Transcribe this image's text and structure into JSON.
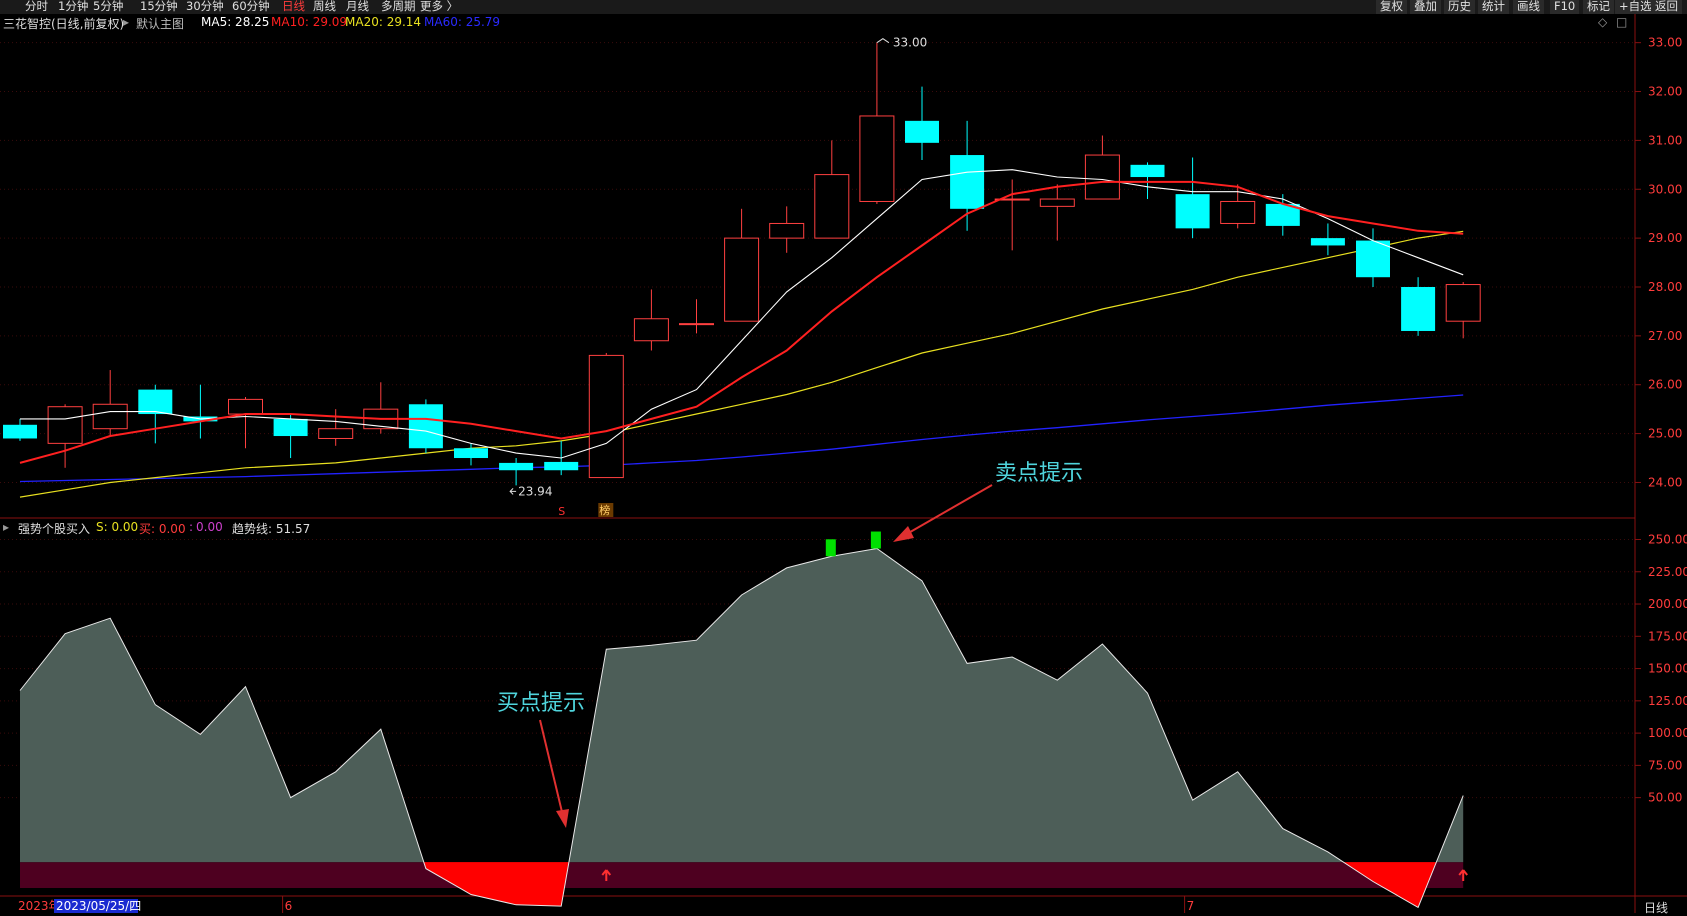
{
  "toolbar": {
    "tabs": [
      "分时",
      "1分钟",
      "5分钟",
      "15分钟",
      "30分钟",
      "60分钟",
      "日线",
      "周线",
      "月线",
      "多周期",
      "更多 〉"
    ],
    "active_tab": "日线",
    "right_buttons": [
      "复权",
      "叠加",
      "历史",
      "统计",
      "画线",
      "F10",
      "标记",
      "+自选",
      "返回"
    ]
  },
  "main_panel": {
    "title": "三花智控(日线,前复权)",
    "template": "默认主图",
    "ma": [
      {
        "label": "MA5: 28.25",
        "color": "#ffffff"
      },
      {
        "label": "MA10: 29.09",
        "color": "#ff2020"
      },
      {
        "label": "MA20: 29.14",
        "color": "#e8e020"
      },
      {
        "label": "MA60: 25.79",
        "color": "#2a2aff"
      }
    ],
    "markers": {
      "high_label": "33.00",
      "low_label": "23.94",
      "s_marker": "S",
      "bang_marker": "榜"
    },
    "window_controls": [
      "◇",
      "□"
    ]
  },
  "sub_panel": {
    "title": "强势个股买入",
    "s_label": "S: 0.00",
    "buy_label": "买: 0.00",
    "sep": ":",
    "zero_label": "0.00",
    "trend_label": "趋势线: 51.57",
    "annotations": {
      "sell": "卖点提示",
      "buy": "买点提示"
    }
  },
  "x_axis": {
    "labels": [
      {
        "text": "2023年",
        "i": 0
      },
      {
        "text": "2023/05/25/四",
        "i": 1,
        "highlight": true
      },
      {
        "text": "6",
        "i": 6
      },
      {
        "text": "7",
        "i": 26
      }
    ]
  },
  "bottom_right": "日线",
  "colors": {
    "up": "#ff4040",
    "down": "#00ffff",
    "ma5": "#ffffff",
    "ma10": "#ff2020",
    "ma20": "#e8e020",
    "ma60": "#2222ff",
    "area": "#4d5e58",
    "neg": "#ff0000",
    "band": "#4e0020",
    "axis": "#ff3c3c",
    "buy_arrow": "#ff3030",
    "sell_mark": "#00e000"
  },
  "chart_data": [
    {
      "type": "candlestick",
      "title": "三花智控(日线,前复权)",
      "ylim": [
        23.6,
        33.3
      ],
      "y_ticks": [
        24,
        25,
        26,
        27,
        28,
        29,
        30,
        31,
        32,
        33
      ],
      "candles": [
        {
          "o": 25.18,
          "c": 24.9,
          "h": 25.3,
          "l": 24.85
        },
        {
          "o": 24.8,
          "c": 25.55,
          "h": 25.6,
          "l": 24.3
        },
        {
          "o": 25.1,
          "c": 25.6,
          "h": 26.3,
          "l": 24.95
        },
        {
          "o": 25.9,
          "c": 25.4,
          "h": 26.0,
          "l": 24.8
        },
        {
          "o": 25.35,
          "c": 25.25,
          "h": 26.0,
          "l": 24.9
        },
        {
          "o": 25.4,
          "c": 25.7,
          "h": 25.75,
          "l": 24.7
        },
        {
          "o": 25.3,
          "c": 24.95,
          "h": 25.4,
          "l": 24.5
        },
        {
          "o": 24.9,
          "c": 25.1,
          "h": 25.5,
          "l": 24.75
        },
        {
          "o": 25.1,
          "c": 25.5,
          "h": 26.05,
          "l": 25.0
        },
        {
          "o": 25.6,
          "c": 24.7,
          "h": 25.7,
          "l": 24.6
        },
        {
          "o": 24.7,
          "c": 24.5,
          "h": 24.8,
          "l": 24.35
        },
        {
          "o": 24.4,
          "c": 24.25,
          "h": 24.5,
          "l": 23.94
        },
        {
          "o": 24.42,
          "c": 24.25,
          "h": 24.85,
          "l": 24.15
        },
        {
          "o": 24.1,
          "c": 26.6,
          "h": 26.65,
          "l": 24.1
        },
        {
          "o": 26.9,
          "c": 27.35,
          "h": 27.95,
          "l": 26.7
        },
        {
          "o": 27.25,
          "c": 27.25,
          "h": 27.75,
          "l": 27.05
        },
        {
          "o": 27.3,
          "c": 29.0,
          "h": 29.6,
          "l": 27.3
        },
        {
          "o": 29.0,
          "c": 29.3,
          "h": 29.65,
          "l": 28.7
        },
        {
          "o": 29.0,
          "c": 30.3,
          "h": 31.0,
          "l": 29.0
        },
        {
          "o": 29.75,
          "c": 31.5,
          "h": 33.0,
          "l": 29.7
        },
        {
          "o": 31.4,
          "c": 30.95,
          "h": 32.1,
          "l": 30.6
        },
        {
          "o": 30.7,
          "c": 29.6,
          "h": 31.4,
          "l": 29.15
        },
        {
          "o": 29.8,
          "c": 29.8,
          "h": 30.2,
          "l": 28.75
        },
        {
          "o": 29.65,
          "c": 29.8,
          "h": 30.1,
          "l": 28.95
        },
        {
          "o": 29.8,
          "c": 30.7,
          "h": 31.1,
          "l": 29.8
        },
        {
          "o": 30.5,
          "c": 30.25,
          "h": 30.55,
          "l": 29.8
        },
        {
          "o": 29.9,
          "c": 29.2,
          "h": 30.65,
          "l": 29.0
        },
        {
          "o": 29.3,
          "c": 29.75,
          "h": 30.1,
          "l": 29.2
        },
        {
          "o": 29.7,
          "c": 29.25,
          "h": 29.9,
          "l": 29.05
        },
        {
          "o": 29.0,
          "c": 28.85,
          "h": 29.3,
          "l": 28.65
        },
        {
          "o": 28.95,
          "c": 28.2,
          "h": 29.2,
          "l": 28.0
        },
        {
          "o": 28.0,
          "c": 27.1,
          "h": 28.2,
          "l": 27.0
        },
        {
          "o": 27.3,
          "c": 28.05,
          "h": 28.1,
          "l": 26.95
        }
      ],
      "ma5": [
        25.3,
        25.3,
        25.45,
        25.45,
        25.3,
        25.35,
        25.3,
        25.25,
        25.15,
        25.05,
        24.8,
        24.6,
        24.5,
        24.8,
        25.5,
        25.9,
        26.9,
        27.9,
        28.6,
        29.4,
        30.2,
        30.35,
        30.4,
        30.25,
        30.2,
        30.05,
        29.95,
        29.95,
        29.8,
        29.4,
        28.95,
        28.6,
        28.25
      ],
      "ma10": [
        24.4,
        24.65,
        24.95,
        25.1,
        25.25,
        25.4,
        25.4,
        25.35,
        25.3,
        25.3,
        25.2,
        25.05,
        24.9,
        25.05,
        25.3,
        25.55,
        26.15,
        26.7,
        27.5,
        28.2,
        28.85,
        29.5,
        29.9,
        30.05,
        30.15,
        30.15,
        30.15,
        30.05,
        29.7,
        29.45,
        29.3,
        29.15,
        29.09
      ],
      "ma20": [
        23.7,
        23.85,
        24.0,
        24.1,
        24.2,
        24.3,
        24.35,
        24.4,
        24.5,
        24.6,
        24.7,
        24.75,
        24.85,
        25.0,
        25.2,
        25.4,
        25.6,
        25.8,
        26.05,
        26.35,
        26.65,
        26.85,
        27.05,
        27.3,
        27.55,
        27.75,
        27.95,
        28.2,
        28.4,
        28.6,
        28.8,
        29.0,
        29.14
      ],
      "ma60": [
        24.02,
        24.04,
        24.06,
        24.08,
        24.1,
        24.12,
        24.15,
        24.18,
        24.21,
        24.24,
        24.27,
        24.3,
        24.32,
        24.35,
        24.4,
        24.45,
        24.52,
        24.6,
        24.68,
        24.78,
        24.88,
        24.97,
        25.05,
        25.12,
        25.2,
        25.28,
        25.35,
        25.42,
        25.5,
        25.58,
        25.65,
        25.72,
        25.79
      ]
    },
    {
      "type": "area",
      "title": "强势个股买入",
      "ylim": [
        -20,
        262
      ],
      "y_ticks": [
        50,
        75,
        100,
        125,
        150,
        175,
        200,
        225,
        250
      ],
      "trend": [
        133,
        177,
        189,
        122,
        99,
        136,
        50,
        70,
        103,
        -5,
        -25,
        -33,
        -34,
        165,
        168,
        172,
        207,
        228,
        237,
        243,
        218,
        154,
        159,
        141,
        169,
        131,
        48,
        70,
        26,
        8,
        -15,
        -35,
        51.57
      ],
      "band": [
        0,
        -20
      ],
      "sell_points": [
        18,
        19
      ],
      "buy_arrows": [
        13,
        32
      ]
    }
  ]
}
